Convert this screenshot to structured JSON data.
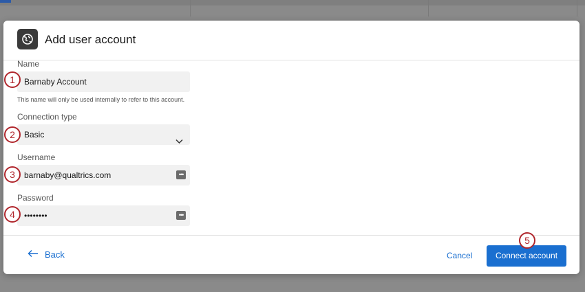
{
  "modal": {
    "title": "Add user account",
    "header_icon": "globe-icon"
  },
  "form": {
    "name": {
      "label": "Name",
      "value": "Barnaby Account",
      "hint": "This name will only be used internally to refer to this account."
    },
    "connection_type": {
      "label": "Connection type",
      "value": "Basic"
    },
    "username": {
      "label": "Username",
      "value": "barnaby@qualtrics.com"
    },
    "password": {
      "label": "Password",
      "value": "••••••••"
    }
  },
  "footer": {
    "back_label": "Back",
    "cancel_label": "Cancel",
    "connect_label": "Connect account"
  },
  "annotations": [
    "1",
    "2",
    "3",
    "4",
    "5"
  ],
  "colors": {
    "accent": "#1a6fd0",
    "annotation": "#b0262c",
    "field_bg": "#f1f1f1"
  }
}
